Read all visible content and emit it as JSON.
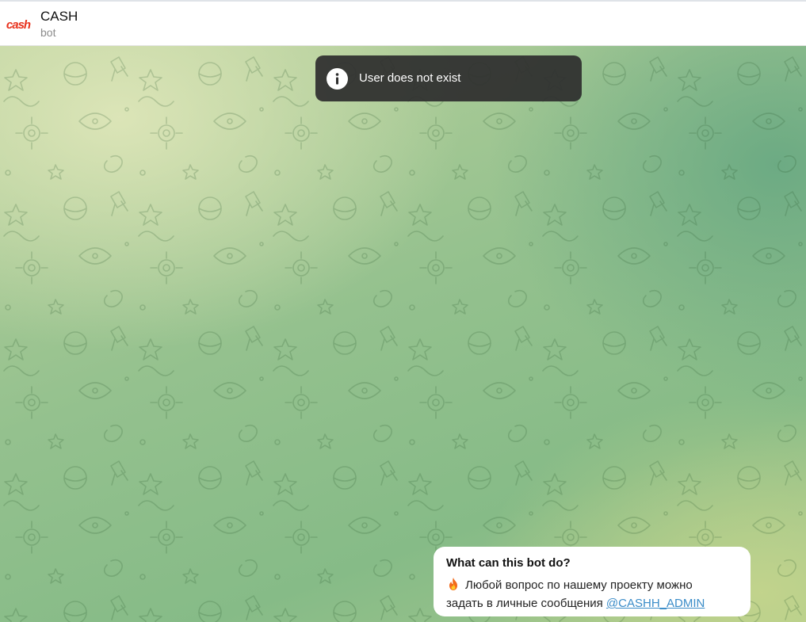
{
  "header": {
    "avatar_text": "cash",
    "title": "CASH",
    "subtitle": "bot"
  },
  "toast": {
    "icon": "info-icon",
    "message": "User does not exist"
  },
  "bot_info": {
    "heading": "What can this bot do?",
    "emoji": "fire-icon",
    "text_line1": "Любой вопрос по нашему проекту можно",
    "text_line2": "задать в личные сообщения ",
    "mention": "@CASHH_ADMIN"
  },
  "colors": {
    "avatar_brand": "#e8321d",
    "mention": "#3a8cc8",
    "toast_bg": "#2e2e2e"
  }
}
